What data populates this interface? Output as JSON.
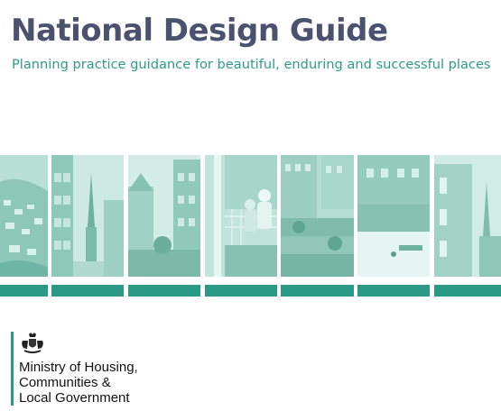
{
  "header": {
    "title": "National Design Guide",
    "subtitle": "Planning practice guidance for beautiful, enduring and successful places"
  },
  "photos": [
    {
      "icon": "hillside-town-photo"
    },
    {
      "icon": "street-with-church-spire-photo"
    },
    {
      "icon": "courtyard-buildings-photo"
    },
    {
      "icon": "people-on-balcony-photo"
    },
    {
      "icon": "stepped-gardens-photo"
    },
    {
      "icon": "public-square-photo"
    },
    {
      "icon": "brick-building-with-spire-photo"
    }
  ],
  "logo": {
    "icon": "royal-coat-of-arms-icon",
    "lines": [
      "Ministry of Housing,",
      "Communities &",
      "Local Government"
    ]
  },
  "colors": {
    "title": "#4b5270",
    "accent": "#2a9a86",
    "photo_tint": "#a8d6cb"
  }
}
